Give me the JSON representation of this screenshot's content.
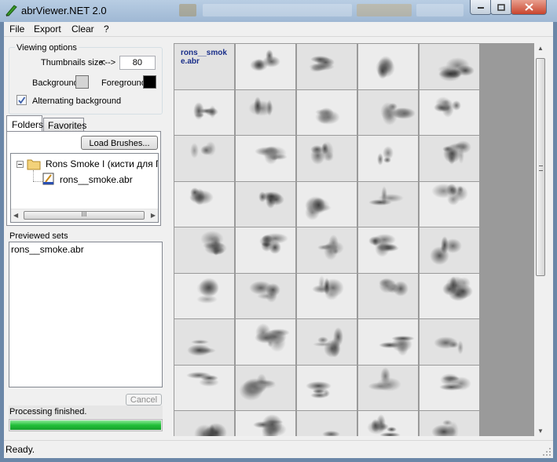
{
  "window": {
    "title": "abrViewer.NET 2.0"
  },
  "menu": {
    "items": [
      "File",
      "Export",
      "Clear",
      "?"
    ]
  },
  "viewing_options": {
    "legend": "Viewing options",
    "thumb_size_label": "Thumbnails size:",
    "thumb_size_arrow": "<-->",
    "thumb_size_value": "80",
    "background_label": "Background:",
    "background_color": "#d4d4d4",
    "foreground_label": "Foreground:",
    "foreground_color": "#000000",
    "alternating_label": "Alternating background",
    "alternating_checked": true
  },
  "tabs": [
    "Folders",
    "Favorites"
  ],
  "folders": {
    "load_button": "Load Brushes...",
    "tree_folder": "Rons Smoke I (кисти для ПП)",
    "tree_file": "rons__smoke.abr",
    "scroll_grip": "III"
  },
  "previewed": {
    "label": "Previewed sets",
    "items": [
      "rons__smoke.abr"
    ]
  },
  "cancel_button": "Cancel",
  "progress": {
    "label": "Processing finished.",
    "fraction": 1.0,
    "color": "#22c039"
  },
  "status": {
    "text": "Ready."
  },
  "grid": {
    "first_cell_label": "rons__smok e.abr",
    "columns": 5,
    "visible_rows": 9,
    "label_color": "#1a2f8a"
  },
  "icons": {
    "app": "brush-pencil-icon",
    "folder": "folder-icon",
    "file": "abr-file-icon"
  }
}
